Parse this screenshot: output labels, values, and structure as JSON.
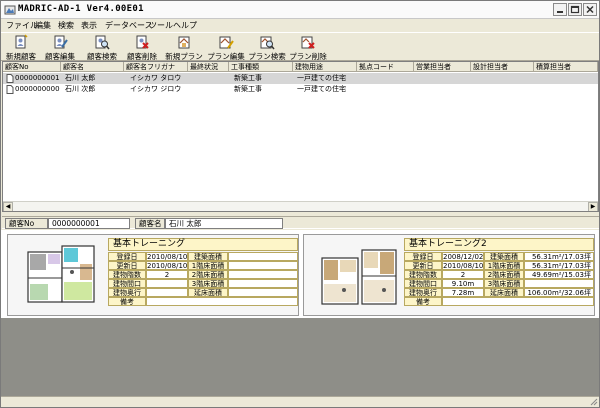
{
  "window": {
    "title": "MADRIC-AD-1 Ver4.00E01"
  },
  "menu": [
    "ファイル",
    "編集",
    "検索",
    "表示",
    "データベース",
    "ツール",
    "ヘルプ"
  ],
  "toolbar": [
    {
      "label": "新規顧客",
      "icon": "new-customer-icon"
    },
    {
      "label": "顧客編集",
      "icon": "edit-customer-icon"
    },
    {
      "label": "顧客検索",
      "icon": "search-customer-icon"
    },
    {
      "label": "顧客削除",
      "icon": "delete-customer-icon"
    },
    {
      "label": "新規プラン",
      "icon": "new-plan-icon"
    },
    {
      "label": "プラン編集",
      "icon": "edit-plan-icon"
    },
    {
      "label": "プラン検索",
      "icon": "search-plan-icon"
    },
    {
      "label": "プラン削除",
      "icon": "delete-plan-icon"
    }
  ],
  "grid": {
    "columns": [
      "顧客No",
      "顧客名",
      "顧客名フリガナ",
      "最終状況",
      "工事種類",
      "建物用途",
      "拠点コード",
      "営業担当者",
      "設計担当者",
      "積算担当者"
    ],
    "rows": [
      {
        "no": "0000000001",
        "name": "石川 太郎",
        "kana": "イシカワ タロウ",
        "status": "",
        "work": "新築工事",
        "usage": "一戸建ての住宅",
        "selected": true
      },
      {
        "no": "0000000000",
        "name": "石川 次郎",
        "kana": "イシカワ ジロウ",
        "status": "",
        "work": "新築工事",
        "usage": "一戸建ての住宅",
        "selected": false
      }
    ]
  },
  "info": {
    "no_label": "顧客No",
    "no_value": "0000000001",
    "name_label": "顧客名",
    "name_value": "石川 太郎"
  },
  "labels": {
    "registered": "登録日",
    "updated": "更新日",
    "floors": "建物階数",
    "frontage": "建物間口",
    "depth": "建物奥行",
    "note": "備考",
    "area_building": "建築面積",
    "area_1f": "1階床面積",
    "area_2f": "2階床面積",
    "area_3f": "3階床面積",
    "area_total": "延床面積"
  },
  "plans": [
    {
      "title": "基本トレーニング",
      "registered": "2010/08/10",
      "updated": "2010/08/10",
      "floors": "2",
      "frontage": "",
      "depth": "",
      "note": "",
      "area_building": "",
      "area_1f": "",
      "area_2f": "",
      "area_3f": "",
      "area_total": ""
    },
    {
      "title": "基本トレーニング2",
      "registered": "2008/12/02",
      "updated": "2010/08/10",
      "floors": "2",
      "frontage": "9.10m",
      "depth": "7.28m",
      "note": "",
      "area_building": "56.31m²/17.03坪",
      "area_1f": "56.31m²/17.03坪",
      "area_2f": "49.69m²/15.03坪",
      "area_3f": "",
      "area_total": "106.00m²/32.06坪"
    }
  ]
}
